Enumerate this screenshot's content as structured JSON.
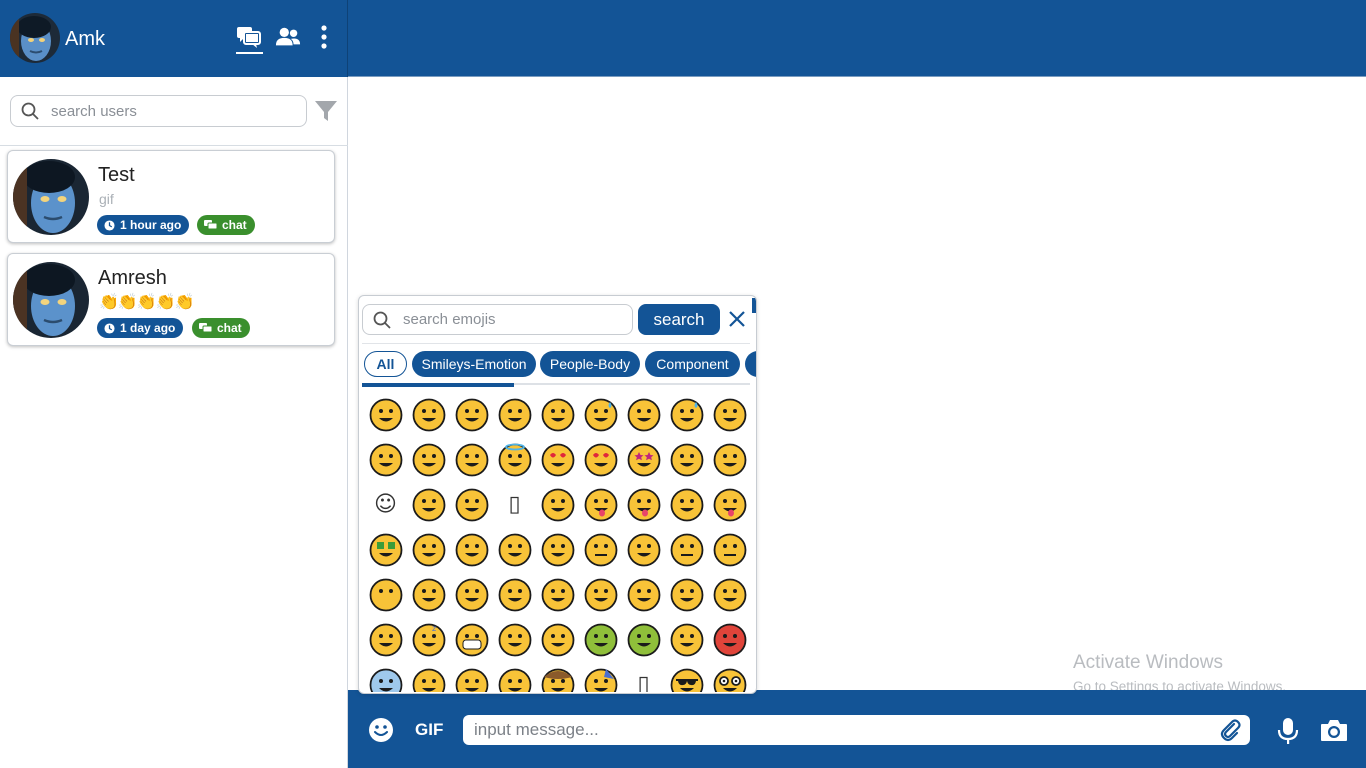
{
  "app": {
    "current_user": "Amk"
  },
  "sidebar": {
    "search_placeholder": "search users",
    "chats": [
      {
        "name": "Test",
        "last_message": "gif",
        "time": "1 hour ago",
        "tag": "chat"
      },
      {
        "name": "Amresh",
        "last_message": "👏👏👏👏👏",
        "time": "1 day ago",
        "tag": "chat"
      }
    ]
  },
  "composer": {
    "gif_label": "GIF",
    "input_placeholder": "input message..."
  },
  "emoji_picker": {
    "search_placeholder": "search emojis",
    "search_button": "search",
    "categories": [
      "All",
      "Smileys-Emotion",
      "People-Body",
      "Component"
    ],
    "active_category": "All",
    "rows": [
      [
        "grinning-face",
        "grinning-face-big-eyes",
        "grinning-face-smiling-eyes",
        "beaming-face",
        "grinning-squinting-face",
        "grinning-face-sweat",
        "rolling-on-floor-laughing",
        "face-tears-of-joy",
        "slightly-smiling-face"
      ],
      [
        "upside-down-face",
        "winking-face",
        "smiling-face-smiling-eyes",
        "smiling-face-halo",
        "smiling-face-hearts",
        "heart-eyes",
        "star-struck",
        "face-blowing-kiss",
        "kissing-face"
      ],
      [
        "☺",
        "kissing-face-closed-eyes",
        "kissing-face-smiling-eyes",
        "▯",
        "face-savoring-food",
        "face-with-tongue",
        "winking-face-tongue",
        "zany-face",
        "squinting-face-tongue"
      ],
      [
        "money-mouth-face",
        "hugging-face",
        "hand-over-mouth",
        "shushing-face",
        "thinking-face",
        "zipper-mouth-face",
        "raised-eyebrow",
        "neutral-face",
        "expressionless-face"
      ],
      [
        "face-without-mouth",
        "smirking-face",
        "unamused-face",
        "face-rolling-eyes",
        "grimacing-face",
        "lying-face",
        "relieved-face",
        "pensive-face",
        "sleepy-face"
      ],
      [
        "drooling-face",
        "sleeping-face",
        "medical-mask",
        "face-thermometer",
        "head-bandage",
        "nauseated-face",
        "vomiting-face",
        "sneezing-face",
        "hot-face"
      ],
      [
        "cold-face",
        "woozy-face",
        "dizzy-face",
        "exploding-head",
        "cowboy-hat-face",
        "partying-face",
        "▯",
        "smiling-sunglasses",
        "nerd-face"
      ]
    ]
  },
  "system": {
    "activate_title": "Activate Windows",
    "activate_subtitle": "Go to Settings to activate Windows."
  },
  "colors": {
    "primary": "#135496",
    "chat_badge": "#3a8f2d",
    "emoji_face": "#f8c338",
    "emoji_outline": "#1b1b1b"
  }
}
